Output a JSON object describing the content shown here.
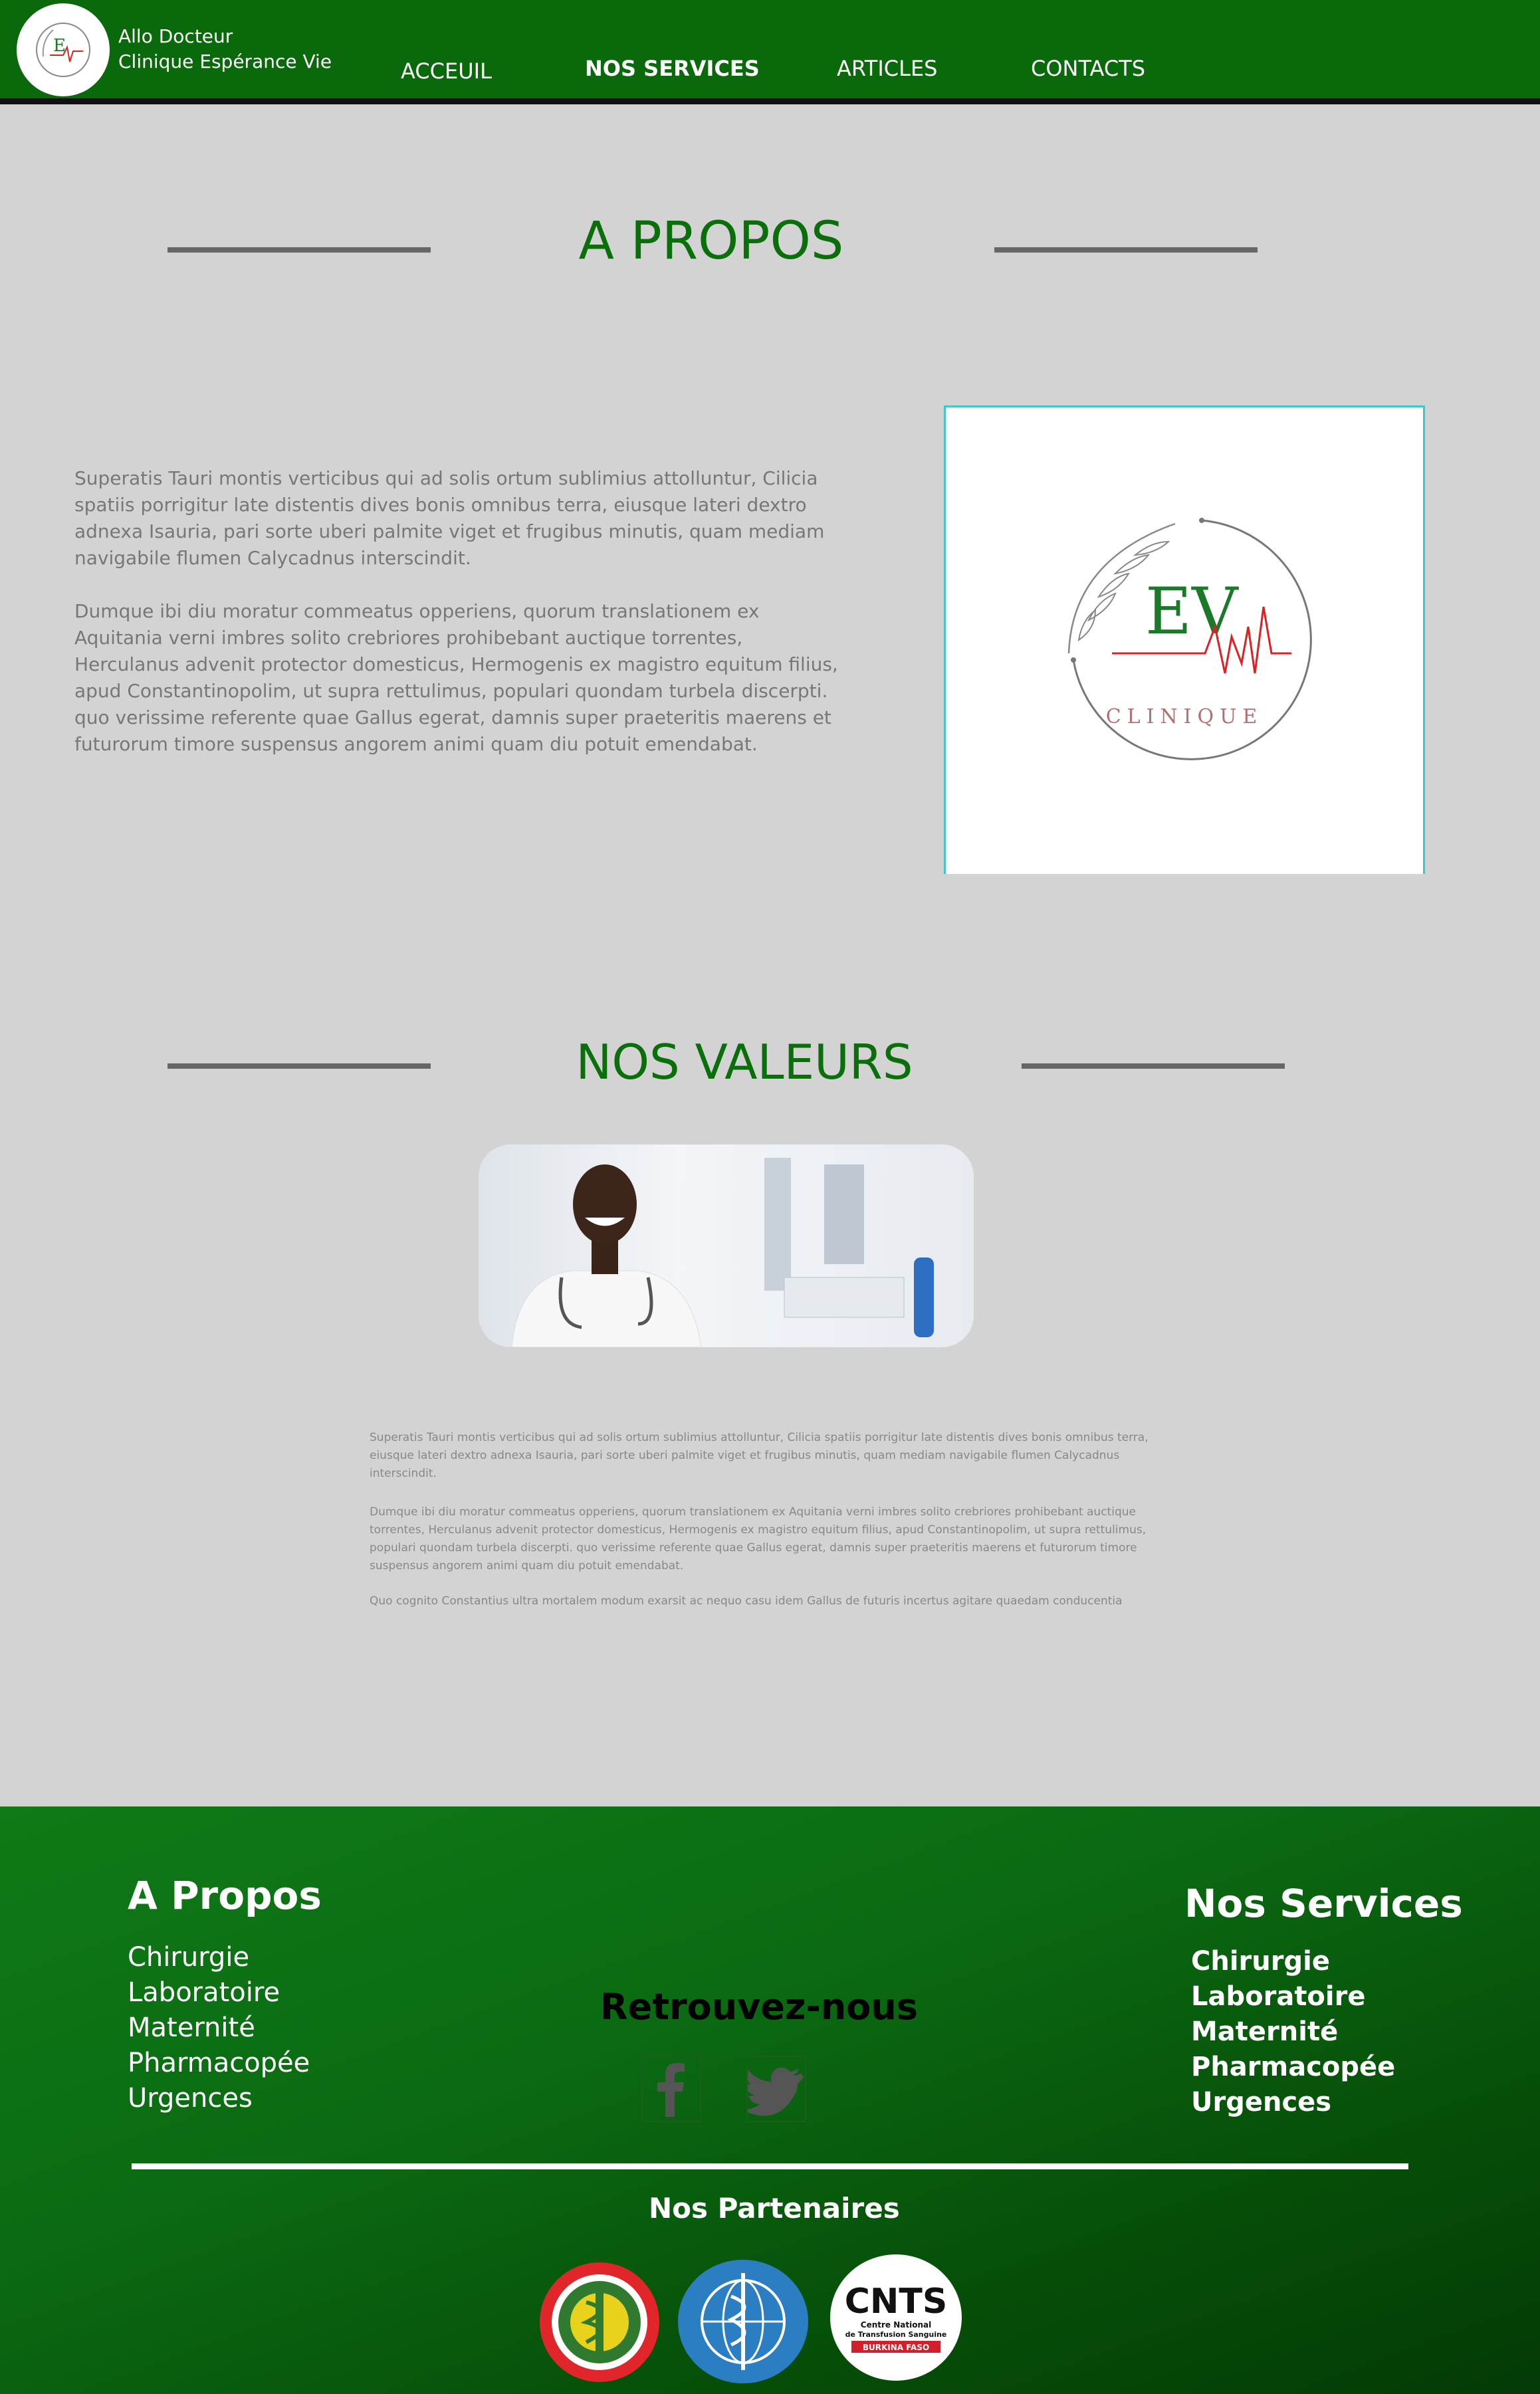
{
  "header": {
    "brand_line1": "Allo Docteur",
    "brand_line2": "Clinique Espérance Vie",
    "nav": [
      {
        "label": "ACCEUIL"
      },
      {
        "label": "NOS SERVICES"
      },
      {
        "label": "ARTICLES"
      },
      {
        "label": "CONTACTS"
      }
    ]
  },
  "about": {
    "title": "A PROPOS",
    "paragraph1": "Superatis Tauri montis verticibus qui ad solis ortum sublimius attolluntur, Cilicia spatiis porrigitur late distentis dives bonis omnibus terra, eiusque lateri dextro adnexa Isauria, pari sorte uberi palmite viget et frugibus minutis, quam mediam navigabile flumen Calycadnus interscindit.",
    "paragraph2": "Dumque ibi diu moratur commeatus opperiens, quorum translationem ex Aquitania verni imbres solito crebriores prohibebant auctique torrentes, Herculanus advenit protector domesticus, Hermogenis ex magistro equitum filius, apud Constantinopolim, ut supra rettulimus, populari quondam turbela discerpti. quo verissime referente quae Gallus egerat, damnis super praeteritis maerens et futurorum timore suspensus angorem animi quam diu potuit emendabat.",
    "logo_letters": "EV",
    "logo_word": "CLINIQUE"
  },
  "values": {
    "title": "NOS VALEURS",
    "paragraph1": "Superatis Tauri montis verticibus qui ad solis ortum sublimius attolluntur, Cilicia spatiis porrigitur late distentis dives bonis omnibus terra, eiusque lateri dextro adnexa Isauria, pari sorte uberi palmite viget et frugibus minutis, quam mediam navigabile flumen Calycadnus interscindit.",
    "paragraph2": "Dumque ibi diu moratur commeatus opperiens, quorum translationem ex Aquitania verni imbres solito crebriores prohibebant auctique torrentes, Herculanus advenit protector domesticus, Hermogenis ex magistro equitum filius, apud Constantinopolim, ut supra rettulimus, populari quondam turbela discerpti. quo verissime referente quae Gallus egerat, damnis super praeteritis maerens et futurorum timore suspensus angorem animi quam diu potuit emendabat.",
    "paragraph3": "Quo cognito Constantius ultra mortalem modum exarsit ac nequo casu idem Gallus de futuris incertus agitare quaedam conducentia"
  },
  "footer": {
    "left_title": "A Propos",
    "left_items": [
      "Chirurgie",
      "Laboratoire",
      "Maternité",
      "Pharmacopée",
      "Urgences"
    ],
    "center_title": "Retrouvez-nous",
    "social": [
      {
        "icon": "facebook-icon"
      },
      {
        "icon": "twitter-icon"
      }
    ],
    "right_title": "Nos Services",
    "right_items": [
      "Chirurgie",
      "Laboratoire",
      "Maternité",
      "Pharmacopée",
      "Urgences"
    ],
    "partners_title": "Nos Partenaires",
    "partners": {
      "cnts_short": "CNTS",
      "cnts_line1": "Centre National",
      "cnts_line2": "de Transfusion Sanguine",
      "cnts_country": "BURKINA FASO"
    }
  },
  "colors": {
    "brand_green": "#0a690a",
    "title_green": "#0a6e0a",
    "page_bg": "#d3d3d3",
    "accent_red": "#e02020"
  }
}
